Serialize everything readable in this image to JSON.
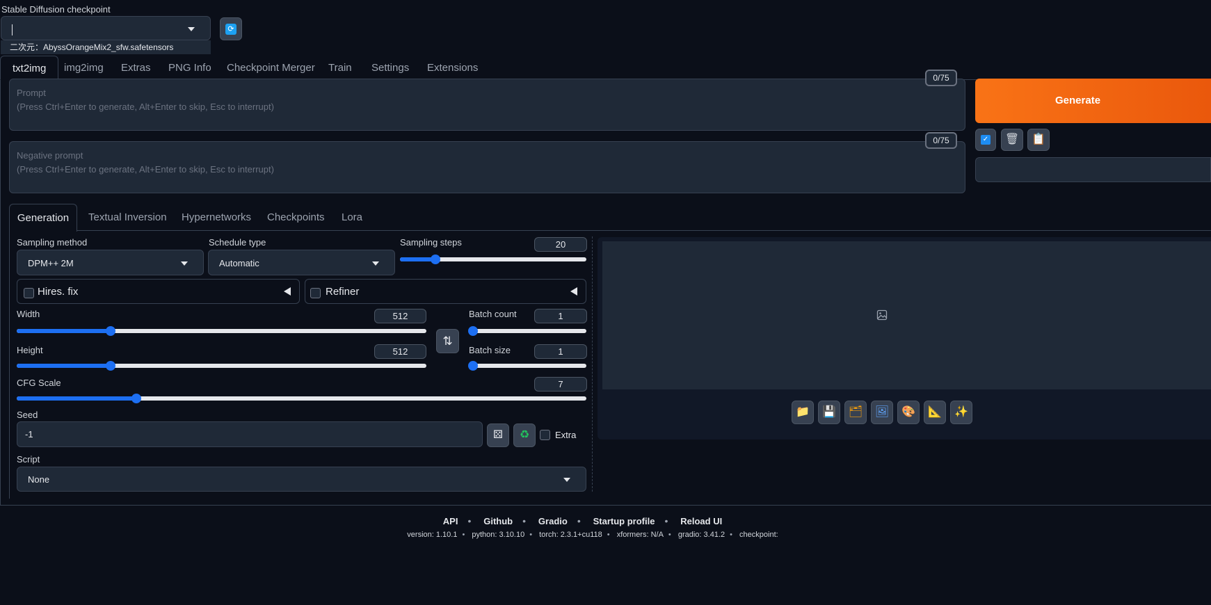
{
  "checkpoint": {
    "label": "Stable Diffusion checkpoint",
    "value": "",
    "option": "二次元：AbyssOrangeMix2_sfw.safetensors",
    "refresh_icon": "refresh-icon"
  },
  "main_tabs": [
    "txt2img",
    "img2img",
    "Extras",
    "PNG Info",
    "Checkpoint Merger",
    "Train",
    "Settings",
    "Extensions"
  ],
  "prompt": {
    "placeholder_title": "Prompt",
    "placeholder_hint": "(Press Ctrl+Enter to generate, Alt+Enter to skip, Esc to interrupt)",
    "counter": "0/75"
  },
  "negative_prompt": {
    "placeholder_title": "Negative prompt",
    "placeholder_hint": "(Press Ctrl+Enter to generate, Alt+Enter to skip, Esc to interrupt)",
    "counter": "0/75"
  },
  "generate": {
    "label": "Generate",
    "color": "#f97316"
  },
  "style_buttons": [
    "checkbox-icon",
    "trash-icon",
    "clipboard-icon"
  ],
  "sub_tabs": [
    "Generation",
    "Textual Inversion",
    "Hypernetworks",
    "Checkpoints",
    "Lora"
  ],
  "sampling_method": {
    "label": "Sampling method",
    "value": "DPM++ 2M"
  },
  "schedule_type": {
    "label": "Schedule type",
    "value": "Automatic"
  },
  "sampling_steps": {
    "label": "Sampling steps",
    "value": "20",
    "fraction": 0.19
  },
  "hires_fix": {
    "label": "Hires. fix"
  },
  "refiner": {
    "label": "Refiner"
  },
  "width": {
    "label": "Width",
    "value": "512",
    "fraction": 0.23
  },
  "height": {
    "label": "Height",
    "value": "512",
    "fraction": 0.23
  },
  "swap_icon": "swap-vertical-icon",
  "batch_count": {
    "label": "Batch count",
    "value": "1",
    "fraction": 0.0
  },
  "batch_size": {
    "label": "Batch size",
    "value": "1",
    "fraction": 0.0
  },
  "cfg_scale": {
    "label": "CFG Scale",
    "value": "7",
    "fraction": 0.21
  },
  "seed": {
    "label": "Seed",
    "value": "-1",
    "extra_label": "Extra"
  },
  "script": {
    "label": "Script",
    "value": "None"
  },
  "output_tools": [
    "folder-icon",
    "save-icon",
    "zip-icon",
    "image-icon",
    "palette-icon",
    "ruler-icon",
    "sparkle-icon"
  ],
  "footer": {
    "links": [
      "API",
      "Github",
      "Gradio",
      "Startup profile",
      "Reload UI"
    ],
    "versions": [
      "version: 1.10.1",
      "python: 3.10.10",
      "torch: 2.3.1+cu118",
      "xformers: N/A",
      "gradio: 3.41.2",
      "checkpoint:"
    ]
  }
}
